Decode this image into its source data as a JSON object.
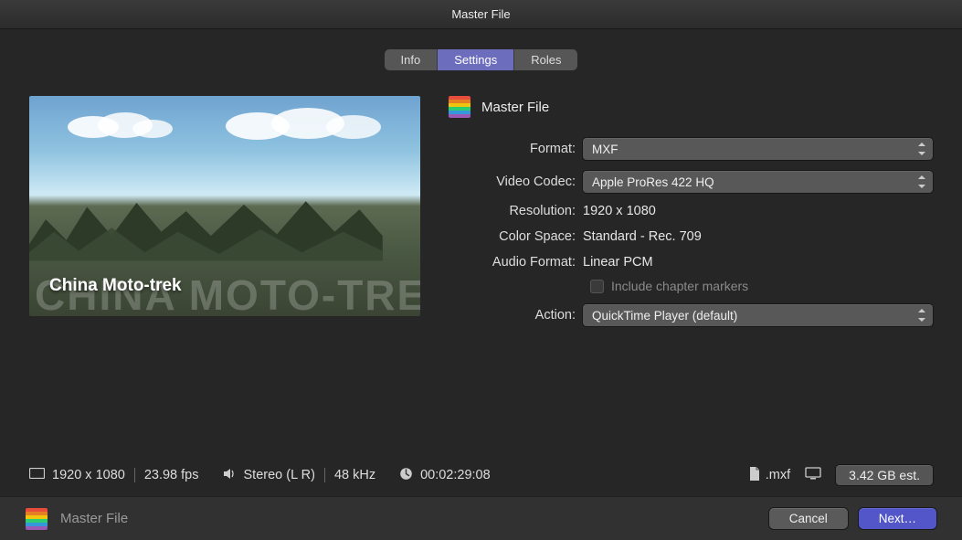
{
  "window": {
    "title": "Master File"
  },
  "tabs": {
    "info": "Info",
    "settings": "Settings",
    "roles": "Roles"
  },
  "preview": {
    "project_title": "China Moto-trek",
    "ghost": "CHINA MOTO-TREK"
  },
  "section": {
    "title": "Master File"
  },
  "form": {
    "format_label": "Format:",
    "format_value": "MXF",
    "codec_label": "Video Codec:",
    "codec_value": "Apple ProRes 422 HQ",
    "resolution_label": "Resolution:",
    "resolution_value": "1920 x 1080",
    "colorspace_label": "Color Space:",
    "colorspace_value": "Standard - Rec. 709",
    "audio_label": "Audio Format:",
    "audio_value": "Linear PCM",
    "chapter_label": "Include chapter markers",
    "action_label": "Action:",
    "action_value": "QuickTime Player (default)"
  },
  "status": {
    "resolution": "1920 x 1080",
    "fps": "23.98 fps",
    "audio": "Stereo (L R)",
    "khz": "48 kHz",
    "duration": "00:02:29:08",
    "ext": ".mxf",
    "size": "3.42 GB est."
  },
  "footer": {
    "title": "Master File",
    "cancel": "Cancel",
    "next": "Next…"
  }
}
